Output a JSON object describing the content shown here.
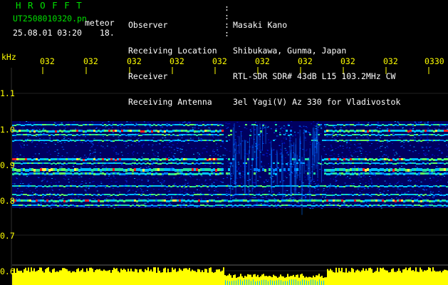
{
  "app": {
    "title": "H R O F F T",
    "file_name": "UT2508010320.pn",
    "mode": "meteor",
    "date_time": "25.08.01 03:20",
    "count": "18."
  },
  "header": {
    "labels": [
      "Observer",
      "Receiving Location",
      "Receiver",
      "Receiving Antenna"
    ],
    "values": [
      "Masaki Kano",
      "Shibukawa, Gunma, Japan",
      "RTL-SDR SDR# 43dB L15 103.2MHz CW",
      "3el Yagi(V) Az 330 for Vladivostok"
    ]
  },
  "axis": {
    "unit": "kHz",
    "freq_labels": [
      "1.1",
      "1.0",
      "0.9",
      "0.8",
      "0.7",
      "0.6"
    ],
    "time_labels": [
      "032",
      "032",
      "032",
      "032",
      "032",
      "032",
      "032",
      "032",
      "032",
      "0330"
    ]
  },
  "colors": {
    "background": "#000000",
    "text": "#ffffff",
    "title": "#00e000",
    "axis": "#ffff00",
    "noise_floor": "#0000a0",
    "signal_strong": "#ff2020",
    "power_bar": "#ffff00",
    "gap_marker": "#00c0ff"
  }
}
